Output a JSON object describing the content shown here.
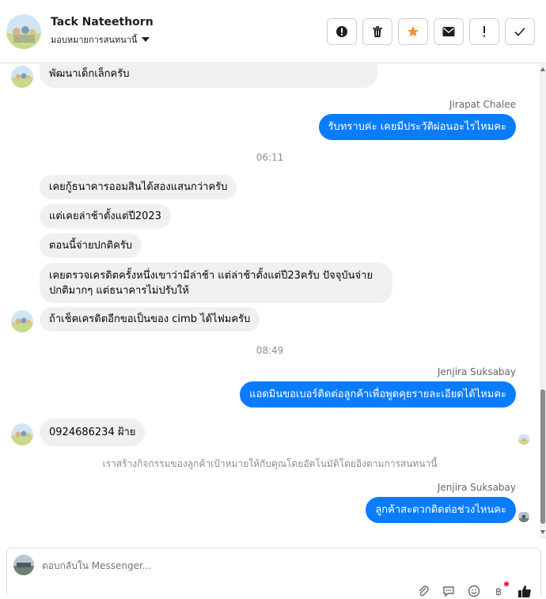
{
  "header": {
    "name": "Tack Nateethorn",
    "subtitle": "มอบหมายการสนทนานี้",
    "actions": [
      {
        "name": "spam-button",
        "icon": "alert-circle-icon"
      },
      {
        "name": "delete-button",
        "icon": "trash-icon"
      },
      {
        "name": "star-button",
        "icon": "star-icon"
      },
      {
        "name": "mark-unread-button",
        "icon": "envelope-icon"
      },
      {
        "name": "follow-up-button",
        "icon": "exclamation-icon"
      },
      {
        "name": "done-button",
        "icon": "check-icon"
      }
    ]
  },
  "colors": {
    "outgoing": "#0a7cff",
    "incoming": "#f0f0f0",
    "star": "#f7923a"
  },
  "messages": [
    {
      "text": "พัฒนาเด็กเล็กครับ"
    },
    {
      "sender": "Jirapat Chalee",
      "text": "รับทราบค่ะ เคยมีประวัติผ่อนอะไรไหมคะ"
    },
    {
      "time": "06:11"
    },
    {
      "text": "เคยกู้ธนาคารออมสินได้สองแสนกว่าครับ"
    },
    {
      "text": "แต่เคยล่าช้าตั้งแต่ปี2023"
    },
    {
      "text": "ตอนนี้จ่ายปกติครับ"
    },
    {
      "text": "เคยตรวจเครดิตครั้งหนึ่งเขาว่ามีล่าช้า แต่ล่าช้าตั้งแต่ปี23ครับ ปัจจุบันจ่าย",
      "text2": "ปกติมากๆ แต่ธนาคารไม่ปรับให้"
    },
    {
      "text": "ถ้าเช็คเครดิตอีกขอเป็นของ cimb ได้ไฟมครับ"
    },
    {
      "time": "08:49"
    },
    {
      "sender": "Jenjira Suksabay",
      "text": "แอดมินขอเบอร์ติดต่อลูกค้าเพื่อพูดคุยรายละเอียดได้ไหมคะ"
    },
    {
      "text": "0924686234 ฝ้าย"
    },
    {
      "notice": "เราสร้างกิจกรรมของลูกค้าเป้าหมายให้กับคุณโดยอัตโนมัติโดยอิงตามการสนทนานี้"
    },
    {
      "sender": "Jenjira Suksabay",
      "text": "ลูกค้าสะดวกติดต่อช่วงไหนคะ"
    }
  ],
  "composer": {
    "placeholder": "ตอบกลับใน Messenger...",
    "tools": [
      "paperclip-icon",
      "chat-bubble-icon",
      "emoji-icon",
      "baht-icon",
      "thumbs-up-icon"
    ]
  }
}
